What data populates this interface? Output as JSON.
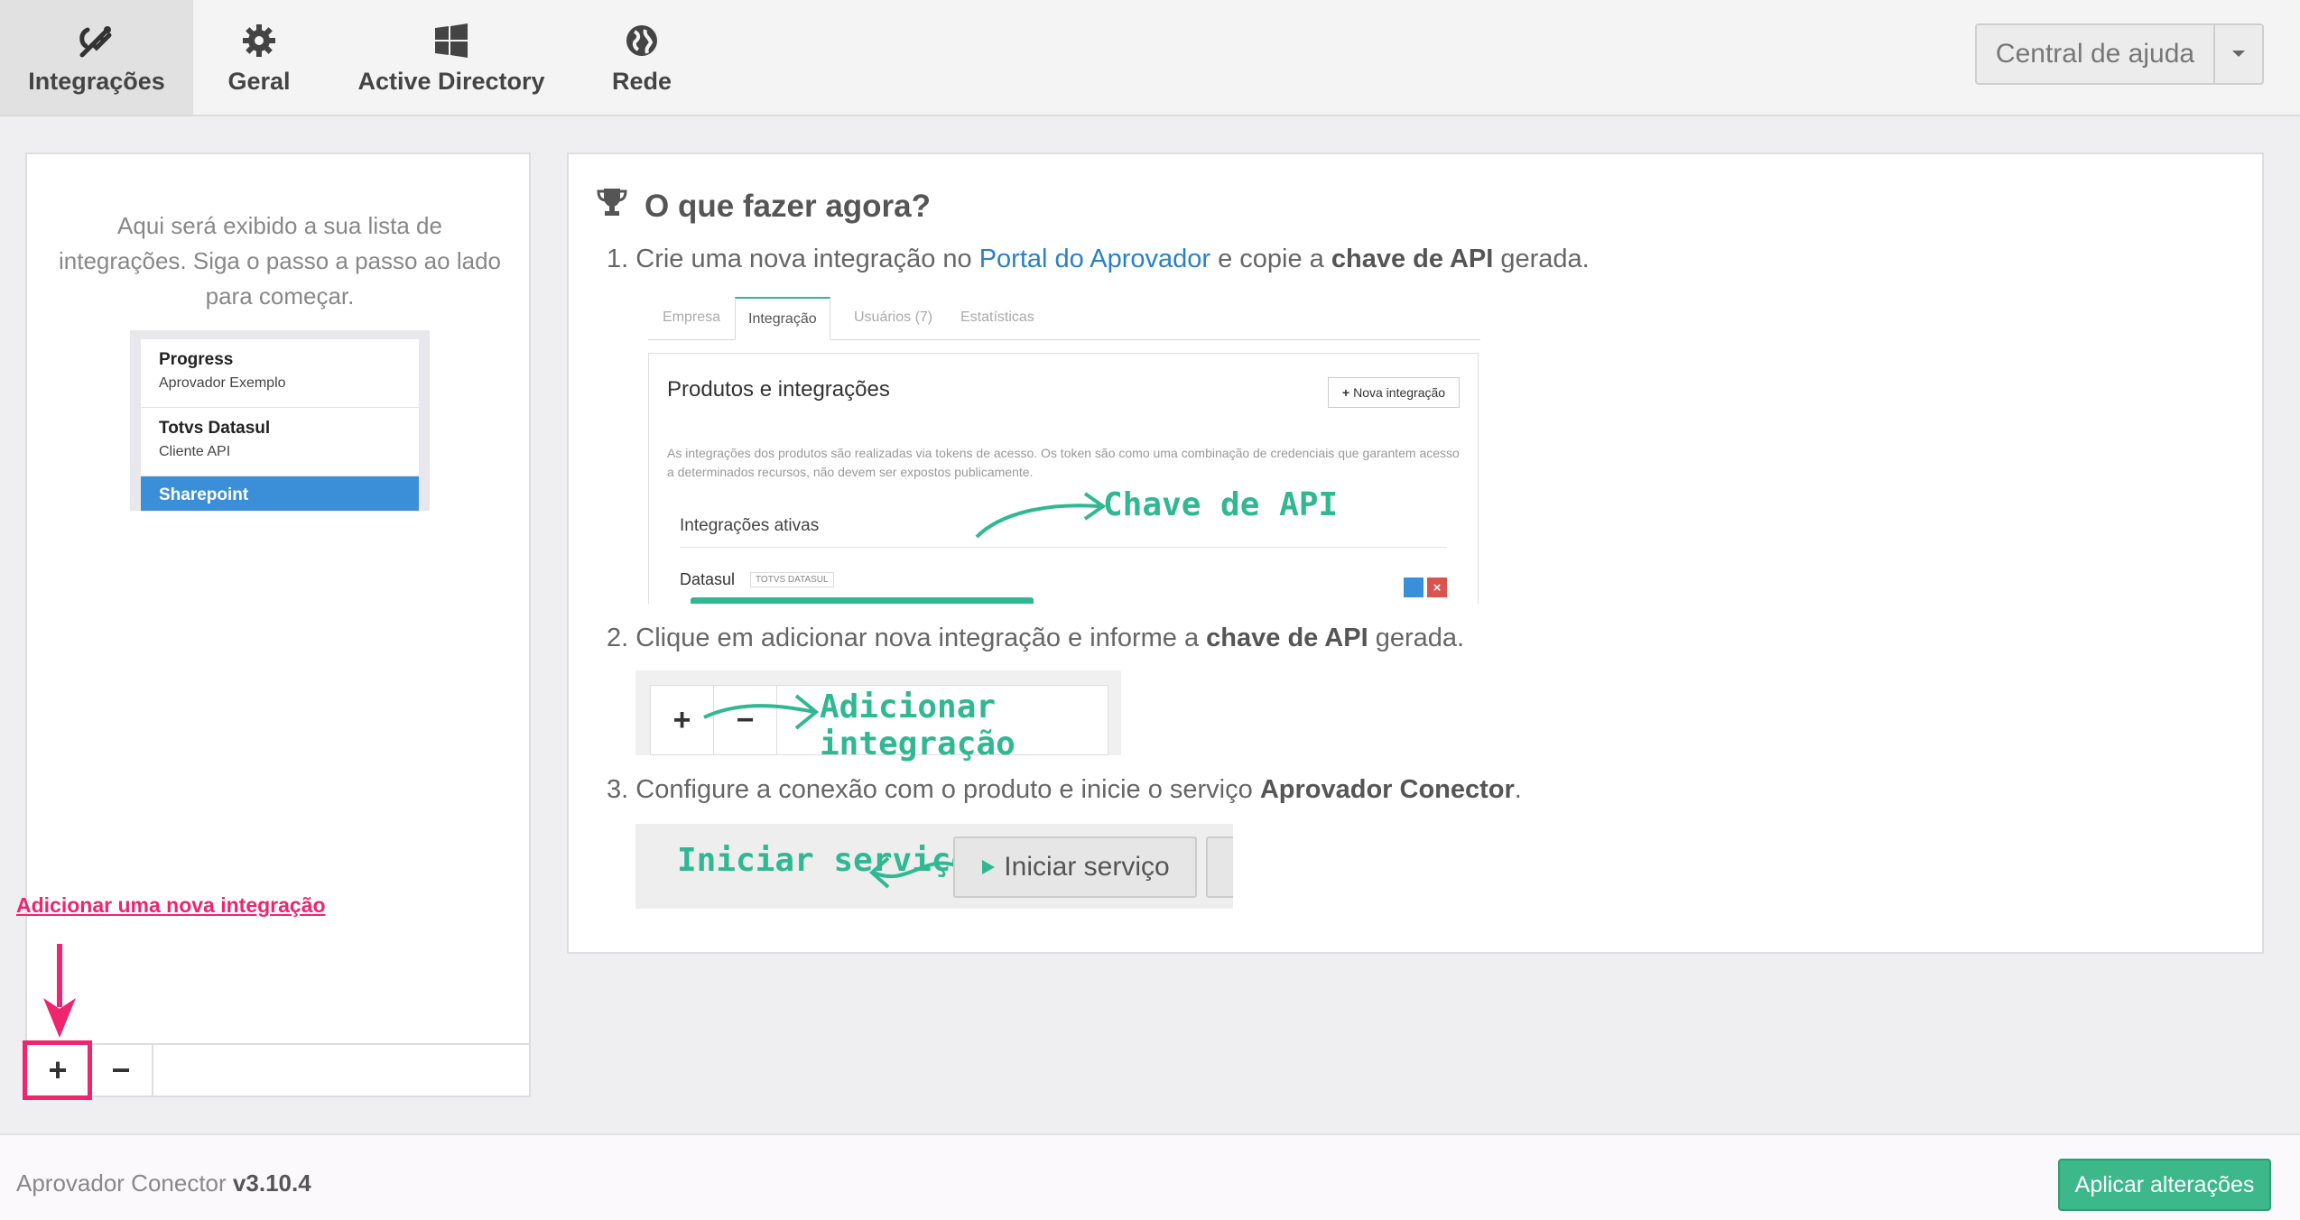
{
  "tabs": [
    {
      "label": "Integrações",
      "icon": "plug-icon",
      "active": true
    },
    {
      "label": "Geral",
      "icon": "gear-icon",
      "active": false
    },
    {
      "label": "Active Directory",
      "icon": "windows-icon",
      "active": false
    },
    {
      "label": "Rede",
      "icon": "globe-icon",
      "active": false
    }
  ],
  "help": {
    "label": "Central de ajuda"
  },
  "left_panel": {
    "hint": "Aqui será exibido a sua lista de integrações. Siga o passo a passo ao lado para começar.",
    "example_items": [
      {
        "title": "Progress",
        "subtitle": "Aprovador Exemplo"
      },
      {
        "title": "Totvs Datasul",
        "subtitle": "Cliente API"
      },
      {
        "title": "Sharepoint",
        "selected": true
      }
    ],
    "add_label": "+",
    "remove_label": "−"
  },
  "annotation": {
    "text": "Adicionar uma nova integração",
    "color": "#f0246f"
  },
  "main": {
    "title": "O que fazer agora?",
    "step1": {
      "num": "1.",
      "pre": "Crie uma nova integração no",
      "link": "Portal do Aprovador",
      "mid": "e copie a",
      "bold": "chave de API",
      "post": "gerada."
    },
    "step2": {
      "num": "2.",
      "pre": "Clique em adicionar nova integração e informe a",
      "bold": "chave de API",
      "post": "gerada."
    },
    "step3": {
      "num": "3.",
      "pre": "Configure a conexão com o produto e inicie o serviço",
      "bold": "Aprovador Conector",
      "post": "."
    },
    "shot1": {
      "tabs": [
        "Empresa",
        "Integração",
        "Usuários (7)",
        "Estatísticas"
      ],
      "heading": "Produtos e integrações",
      "new_button": "Nova integração",
      "description": "As integrações dos produtos são realizadas via tokens de acesso. Os token são como uma combinação de credenciais que garantem acesso a determinados recursos, não devem ser expostos publicamente.",
      "active_label": "Integrações ativas",
      "item_name": "Datasul",
      "item_badge": "TOTVS DATASUL",
      "callout": "Chave de API"
    },
    "shot2": {
      "callout": "Adicionar integração"
    },
    "shot3": {
      "callout": "Iniciar serviço",
      "button": "Iniciar serviço"
    }
  },
  "footer": {
    "app_name": "Aprovador Conector",
    "version": "v3.10.4",
    "apply_label": "Aplicar alterações"
  },
  "colors": {
    "accent_green": "#3cb88b",
    "link_blue": "#2a80c8",
    "annotation_pink": "#f0246f",
    "hand_green": "#2fb892"
  }
}
